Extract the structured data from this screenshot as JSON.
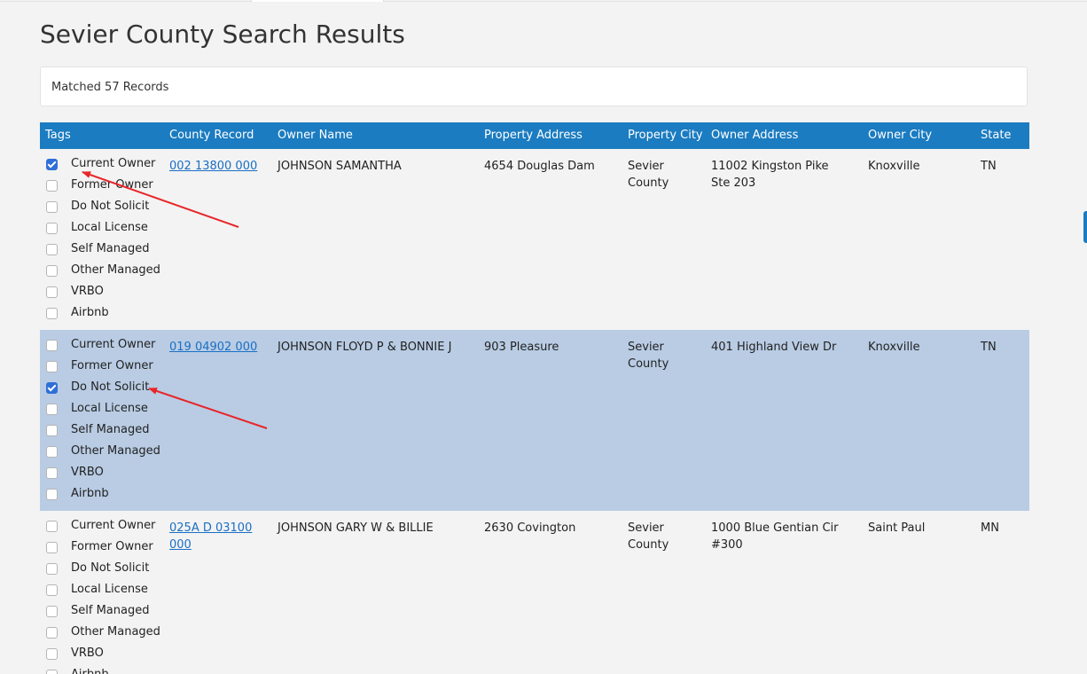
{
  "page": {
    "title": "Sevier County Search Results",
    "match_summary": "Matched 57 Records"
  },
  "table": {
    "headers": {
      "tags": "Tags",
      "county_record": "County Record",
      "owner_name": "Owner Name",
      "property_address": "Property Address",
      "property_city": "Property City",
      "owner_address": "Owner Address",
      "owner_city": "Owner City",
      "state": "State"
    },
    "tag_labels": [
      "Current Owner",
      "Former Owner",
      "Do Not Solicit",
      "Local License",
      "Self Managed",
      "Other Managed",
      "VRBO",
      "Airbnb"
    ],
    "rows": [
      {
        "tags_checked": [
          true,
          false,
          false,
          false,
          false,
          false,
          false,
          false
        ],
        "county_record": "002 13800 000",
        "owner_name": "JOHNSON SAMANTHA",
        "property_address": "4654 Douglas Dam",
        "property_city": "Sevier County",
        "owner_address": "11002 Kingston Pike Ste 203",
        "owner_city": "Knoxville",
        "state": "TN",
        "selected": false
      },
      {
        "tags_checked": [
          false,
          false,
          true,
          false,
          false,
          false,
          false,
          false
        ],
        "county_record": "019 04902 000",
        "owner_name": "JOHNSON FLOYD P & BONNIE J",
        "property_address": "903 Pleasure",
        "property_city": "Sevier County",
        "owner_address": "401 Highland View Dr",
        "owner_city": "Knoxville",
        "state": "TN",
        "selected": true
      },
      {
        "tags_checked": [
          false,
          false,
          false,
          false,
          false,
          false,
          false,
          false
        ],
        "county_record": "025A D 03100 000",
        "owner_name": "JOHNSON GARY W & BILLIE",
        "property_address": "2630 Covington",
        "property_city": "Sevier County",
        "owner_address": "1000 Blue Gentian Cir #300",
        "owner_city": "Saint Paul",
        "state": "MN",
        "selected": false
      }
    ]
  },
  "colors": {
    "header_bg": "#1b7cc1",
    "selected_row_bg": "#b9cce4",
    "link": "#1a6fc4",
    "annotation_arrow": "#e8262a"
  }
}
